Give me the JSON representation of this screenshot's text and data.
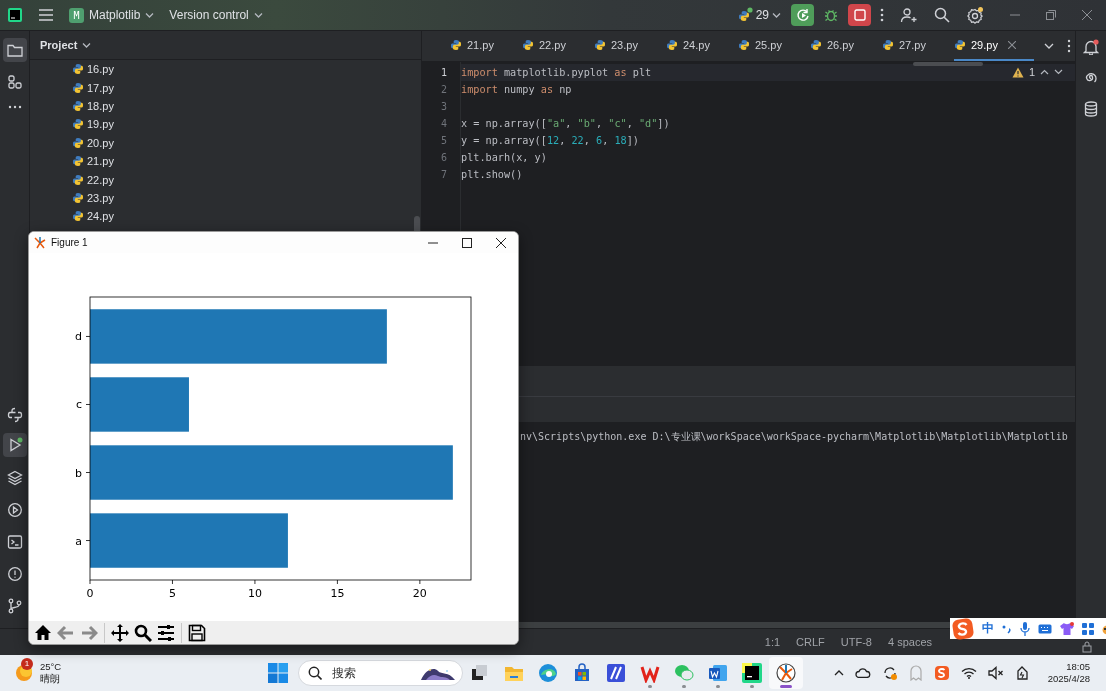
{
  "titlebar": {
    "project_badge": "M",
    "project": "Matplotlib",
    "vcs": "Version control",
    "run_config": "29"
  },
  "project_panel": {
    "title": "Project",
    "files": [
      "16.py",
      "17.py",
      "18.py",
      "19.py",
      "20.py",
      "21.py",
      "22.py",
      "23.py",
      "24.py"
    ]
  },
  "editor_tabs": [
    {
      "label": "21.py",
      "selected": false
    },
    {
      "label": "22.py",
      "selected": false
    },
    {
      "label": "23.py",
      "selected": false
    },
    {
      "label": "24.py",
      "selected": false
    },
    {
      "label": "25.py",
      "selected": false
    },
    {
      "label": "26.py",
      "selected": false
    },
    {
      "label": "27.py",
      "selected": false
    },
    {
      "label": "29.py",
      "selected": true
    }
  ],
  "editor": {
    "warning_count": "1",
    "lines": [
      {
        "number": "1",
        "tokens": [
          {
            "kind": "keyword",
            "text": "import"
          },
          {
            "kind": "plain",
            "text": " matplotlib.pyplot "
          },
          {
            "kind": "keyword",
            "text": "as"
          },
          {
            "kind": "plain",
            "text": " plt"
          }
        ]
      },
      {
        "number": "2",
        "tokens": [
          {
            "kind": "keyword",
            "text": "import"
          },
          {
            "kind": "plain",
            "text": " numpy "
          },
          {
            "kind": "keyword",
            "text": "as"
          },
          {
            "kind": "plain",
            "text": " np"
          }
        ]
      },
      {
        "number": "3"
      },
      {
        "number": "4",
        "tokens": [
          {
            "kind": "plain",
            "text": "x = np.array(["
          },
          {
            "kind": "string",
            "text": "\"a\""
          },
          {
            "kind": "plain",
            "text": ", "
          },
          {
            "kind": "string",
            "text": "\"b\""
          },
          {
            "kind": "plain",
            "text": ", "
          },
          {
            "kind": "string",
            "text": "\"c\""
          },
          {
            "kind": "plain",
            "text": ", "
          },
          {
            "kind": "string",
            "text": "\"d\""
          },
          {
            "kind": "plain",
            "text": "])"
          }
        ]
      },
      {
        "number": "5",
        "tokens": [
          {
            "kind": "plain",
            "text": "y = np.array(["
          },
          {
            "kind": "number",
            "text": "12"
          },
          {
            "kind": "plain",
            "text": ", "
          },
          {
            "kind": "number",
            "text": "22"
          },
          {
            "kind": "plain",
            "text": ", "
          },
          {
            "kind": "number",
            "text": "6"
          },
          {
            "kind": "plain",
            "text": ", "
          },
          {
            "kind": "number",
            "text": "18"
          },
          {
            "kind": "plain",
            "text": "])"
          }
        ]
      },
      {
        "number": "6",
        "tokens": [
          {
            "kind": "plain",
            "text": "plt.barh(x, y)"
          }
        ]
      },
      {
        "number": "7",
        "tokens": [
          {
            "kind": "plain",
            "text": "plt.show()"
          }
        ]
      }
    ]
  },
  "console": {
    "line": "nv\\Scripts\\python.exe D:\\专业课\\workSpace\\workSpace-pycharm\\Matplotlib\\Matplotlib\\Matplotlib"
  },
  "status_bar": {
    "items": [
      "1:1",
      "CRLF",
      "UTF-8",
      "4 spaces"
    ]
  },
  "figure_window": {
    "title": "Figure 1",
    "chart_data": {
      "type": "bar",
      "orientation": "horizontal",
      "categories": [
        "d",
        "c",
        "b",
        "a"
      ],
      "series": [
        {
          "color": "#1f77b4",
          "values": [
            18,
            6,
            22,
            12
          ]
        }
      ],
      "xlim": [
        0,
        23.1
      ],
      "xticks": [
        0,
        5,
        10,
        15,
        20
      ]
    },
    "toolbar": [
      {
        "disabled": false
      },
      {
        "disabled": true
      },
      {
        "disabled": true
      },
      {
        "disabled": false
      },
      {
        "disabled": false
      },
      {
        "disabled": false
      },
      {
        "disabled": false
      }
    ]
  },
  "ime_toolbar": {
    "mode": "中"
  },
  "taskbar": {
    "weather": {
      "badge": "1",
      "temperature": "25°C",
      "condition": "晴朗"
    },
    "search": {
      "placeholder": "搜索"
    },
    "apps": [
      {
        "running": false,
        "selected": false
      },
      {
        "running": false,
        "selected": false
      },
      {
        "running": false,
        "selected": false
      },
      {
        "running": false,
        "selected": false
      },
      {
        "running": false,
        "selected": false
      },
      {
        "running": true,
        "selected": false
      },
      {
        "running": true,
        "selected": false
      },
      {
        "running": true,
        "selected": false
      },
      {
        "running": true,
        "selected": false
      },
      {
        "running": true,
        "selected": true
      }
    ],
    "clock": {
      "time": "18:05",
      "date": "2025/4/28"
    }
  }
}
